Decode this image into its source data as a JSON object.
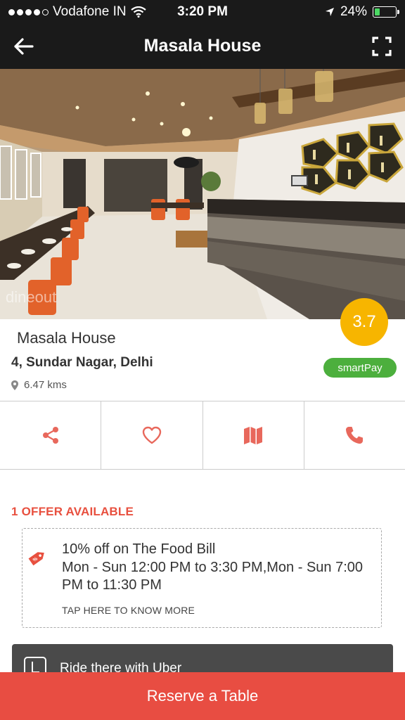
{
  "status_bar": {
    "carrier": "Vodafone IN",
    "time": "3:20 PM",
    "battery": "24%",
    "battery_level": 0.24
  },
  "nav": {
    "title": "Masala House",
    "back_icon": "arrow-left-icon",
    "expand_icon": "fullscreen-icon"
  },
  "hero": {
    "watermark": "dineout"
  },
  "restaurant": {
    "rating": "3.7",
    "name": "Masala House",
    "address": "4, Sundar Nagar, Delhi",
    "distance": "6.47 kms",
    "badge": "smartPay"
  },
  "actions": [
    {
      "name": "share",
      "icon": "share-icon"
    },
    {
      "name": "favorite",
      "icon": "heart-icon"
    },
    {
      "name": "map",
      "icon": "map-icon"
    },
    {
      "name": "call",
      "icon": "phone-icon"
    }
  ],
  "offers": {
    "heading": "1 OFFER AVAILABLE",
    "items": [
      {
        "title": "10% off on The Food Bill",
        "timing": "Mon - Sun   12:00 PM to 3:30 PM,Mon - Sun 7:00 PM to 11:30 PM",
        "cta": "TAP HERE TO KNOW MORE"
      }
    ]
  },
  "uber": {
    "label": "Ride there with Uber"
  },
  "reserve_label": "Reserve a Table",
  "colors": {
    "accent": "#e84d42",
    "rating": "#f7b500",
    "smartpay": "#4caf3d",
    "topbar": "#1a1a1a"
  }
}
